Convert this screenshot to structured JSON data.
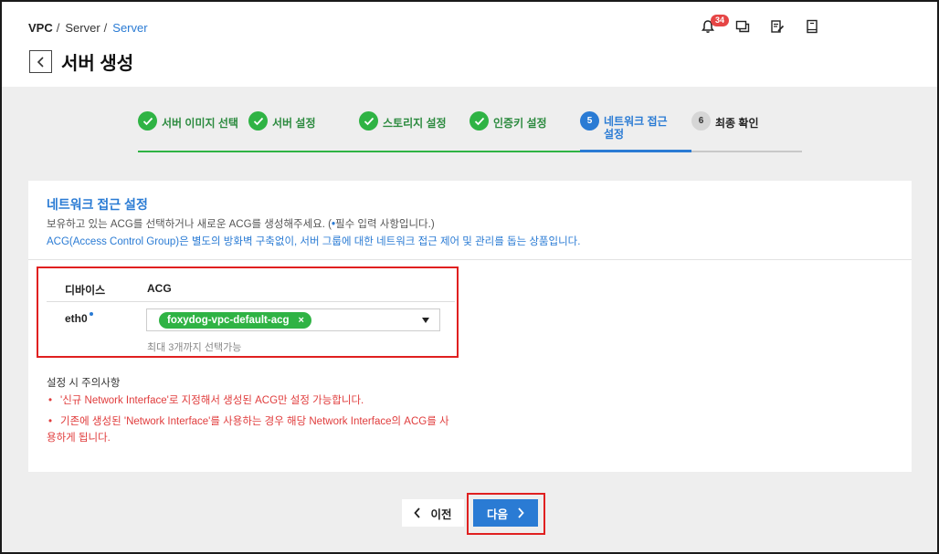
{
  "breadcrumb": {
    "root": "VPC",
    "level1": "Server",
    "current": "Server",
    "separator": "/"
  },
  "page": {
    "title": "서버 생성"
  },
  "header_icons": [
    {
      "name": "bell-icon",
      "badge": "34"
    },
    {
      "name": "chat-icon"
    },
    {
      "name": "edit-note-icon"
    },
    {
      "name": "book-icon"
    }
  ],
  "stepper": {
    "steps": [
      {
        "number": "1",
        "label": "서버 이미지 선택",
        "status": "done"
      },
      {
        "number": "2",
        "label": "서버 설정",
        "status": "done"
      },
      {
        "number": "3",
        "label": "스토리지 설정",
        "status": "done"
      },
      {
        "number": "4",
        "label": "인증키 설정",
        "status": "done"
      },
      {
        "number": "5",
        "label": "네트워크 접근 설정",
        "status": "active"
      },
      {
        "number": "6",
        "label": "최종 확인",
        "status": "pending"
      }
    ],
    "colors": {
      "done": "#2fb344",
      "active": "#2a7bd4",
      "pending": "#d6d6d6"
    }
  },
  "section": {
    "title": "네트워크 접근 설정",
    "description_before": "보유하고 있는 ACG를 선택하거나 새로운 ACG를 생성해주세요. (",
    "required_marker": "•",
    "description_after": "필수 입력 사항입니다.)",
    "info": "ACG(Access Control Group)은 별도의 방화벽 구축없이, 서버 그룹에 대한 네트워크 접근 제어 및 관리를 돕는 상품입니다."
  },
  "acg_table": {
    "headers": {
      "device": "디바이스",
      "acg": "ACG"
    },
    "rows": [
      {
        "device": "eth0",
        "selected": [
          {
            "label": "foxydog-vpc-default-acg",
            "remove": "×"
          }
        ],
        "hint": "최대 3개까지 선택가능"
      }
    ]
  },
  "notice": {
    "title": "설정 시 주의사항",
    "items": [
      "'신규 Network Interface'로 지정해서 생성된 ACG만 설정 가능합니다.",
      "기존에 생성된 'Network Interface'를 사용하는 경우 해당 Network Interface의 ACG를 사",
      "용하게 됩니다."
    ],
    "bullet": "•"
  },
  "buttons": {
    "prev": "이전",
    "next": "다음"
  },
  "colors": {
    "accent": "#2a7bd4",
    "success": "#2fb344",
    "warning": "#e03c3c",
    "highlight": "#e02020"
  }
}
